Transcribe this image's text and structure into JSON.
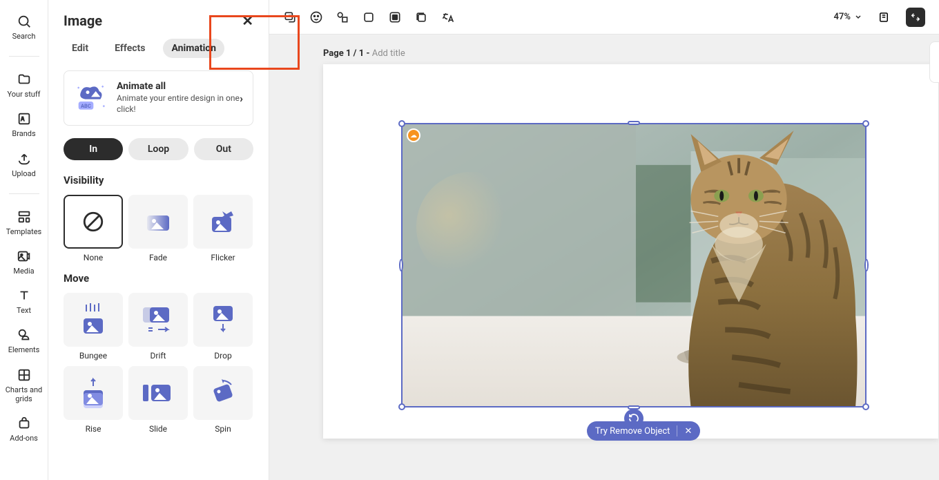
{
  "rail": {
    "search": "Search",
    "stuff": "Your stuff",
    "brands": "Brands",
    "upload": "Upload",
    "templates": "Templates",
    "media": "Media",
    "text": "Text",
    "elements": "Elements",
    "charts": "Charts and grids",
    "addons": "Add-ons"
  },
  "panel": {
    "title": "Image",
    "tabs": {
      "edit": "Edit",
      "effects": "Effects",
      "animation": "Animation"
    },
    "animate_all": {
      "title": "Animate all",
      "sub": "Animate your entire design in one click!"
    },
    "dir": {
      "in": "In",
      "loop": "Loop",
      "out": "Out"
    },
    "visibility": {
      "title": "Visibility",
      "none": "None",
      "fade": "Fade",
      "flicker": "Flicker"
    },
    "move": {
      "title": "Move",
      "bungee": "Bungee",
      "drift": "Drift",
      "drop": "Drop",
      "rise": "Rise",
      "slide": "Slide",
      "spin": "Spin"
    }
  },
  "toolbar": {
    "zoom": "47%"
  },
  "page": {
    "num": "Page 1 / 1 - ",
    "title": "Add title"
  },
  "action": {
    "remove": "Try Remove Object"
  }
}
